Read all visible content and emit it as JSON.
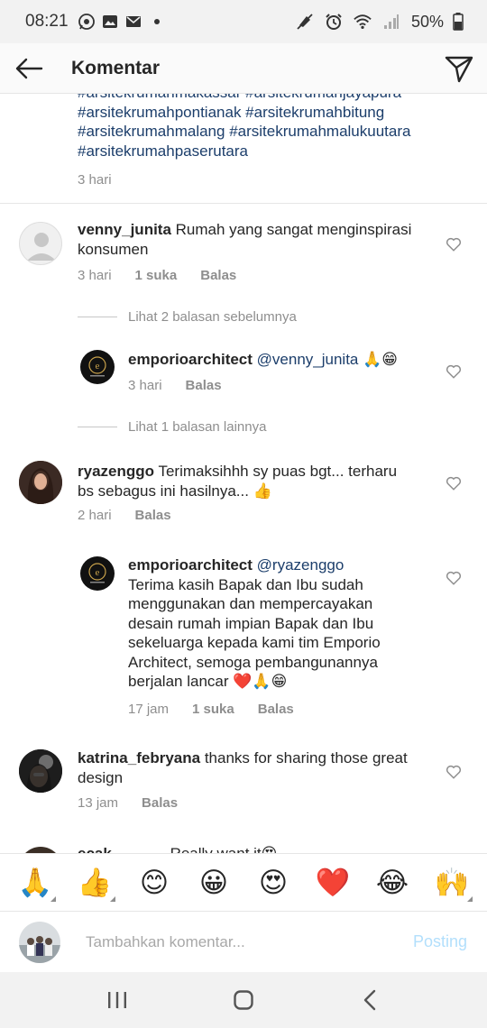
{
  "status_bar": {
    "time": "08:21",
    "battery": "50%",
    "icons": [
      "whatsapp-icon",
      "image-icon",
      "gmail-icon",
      "dot-icon",
      "mute-icon",
      "alarm-icon",
      "wifi-icon",
      "signal-icon",
      "battery-icon"
    ]
  },
  "header": {
    "title": "Komentar",
    "back_icon": "arrow-left-icon",
    "send_icon": "send-paper-plane-icon"
  },
  "caption": {
    "hashtag_lines": [
      "#arsitekrumahmakassar #arsitekrumahjayapura",
      "#arsitekrumahpontianak #arsitekrumahbitung",
      "#arsitekrumahmalang #arsitekrumahmalukuutara",
      "#arsitekrumahpaserutara"
    ],
    "time": "3 hari"
  },
  "comments": [
    {
      "user": "venny_junita",
      "text_line1": "Rumah yang sangat menginspirasi",
      "text_line2": "konsumen",
      "time": "3 hari",
      "likes": "1 suka",
      "reply": "Balas"
    },
    {
      "user": "ryazenggo",
      "text_line1": "Terimaksihhh sy puas bgt... terharu",
      "text_line2": "bs sebagus ini hasilnya... 👍",
      "time": "2 hari",
      "reply": "Balas"
    },
    {
      "user": "katrina_febryana",
      "text_line1": "thanks for sharing those great",
      "text_line2": "design",
      "time": "13 jam",
      "reply": "Balas"
    },
    {
      "user": "ecak",
      "text": "Really want it😍"
    }
  ],
  "view_replies": {
    "first": "Lihat 2 balasan sebelumnya",
    "second": "Lihat 1 balasan lainnya"
  },
  "replies": [
    {
      "user": "emporioarchitect",
      "mention": "@venny_junita",
      "text": "🙏😁",
      "time": "3 hari",
      "reply": "Balas"
    },
    {
      "user": "emporioarchitect",
      "mention": "@ryazenggo",
      "lines": [
        "Terima kasih Bapak dan Ibu sudah",
        "menggunakan dan mempercayakan",
        "desain rumah impian Bapak dan Ibu",
        "sekeluarga kepada kami tim Emporio",
        "Architect, semoga pembangunannya",
        "berjalan lancar ❤️🙏😁"
      ],
      "time": "17 jam",
      "likes": "1 suka",
      "reply": "Balas"
    }
  ],
  "emoji_bar": [
    "🙏",
    "👍",
    "😊",
    "😀",
    "😍",
    "❤️",
    "😂",
    "🙌"
  ],
  "composer": {
    "placeholder": "Tambahkan komentar...",
    "post": "Posting"
  },
  "nav_bar": [
    "recent-apps-icon",
    "home-icon",
    "back-icon"
  ],
  "colors": {
    "hashtag": "#1c3e6b",
    "meta": "#8e8e8e",
    "post_disabled": "#b2dffc",
    "heart_red": "#e0245e"
  }
}
